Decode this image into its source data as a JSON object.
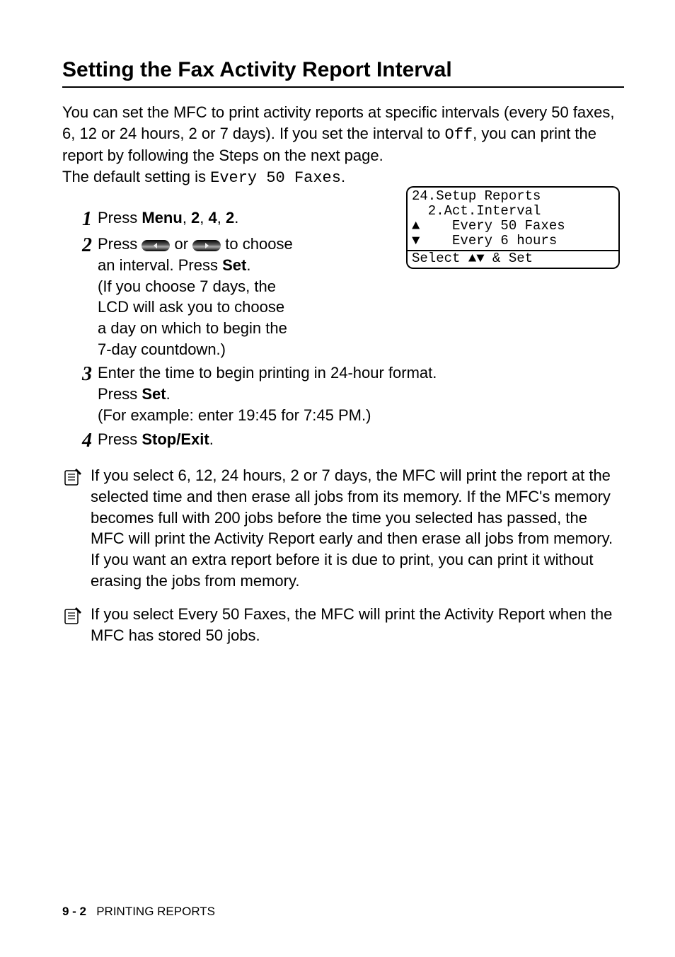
{
  "title": "Setting the Fax Activity Report Interval",
  "intro": {
    "line1": "You can set the MFC to print activity reports at specific intervals (every 50 faxes, 6, 12 or 24 hours, 2 or 7 days). If you set the interval to ",
    "off": "Off",
    "line2": ", you can print the report by following the Steps on the next page.",
    "line3a": "The default setting is ",
    "default_mono": "Every 50 Faxes",
    "line3b": "."
  },
  "steps": {
    "s1": {
      "num": "1",
      "a": "Press ",
      "menu": "Menu",
      "b": ", ",
      "k1": "2",
      "c": ", ",
      "k2": "4",
      "d": ", ",
      "k3": "2",
      "e": "."
    },
    "s2": {
      "num": "2",
      "a": "Press ",
      "b": " or ",
      "c": " to choose an interval. Press ",
      "set": "Set",
      "d": ".",
      "paren": "(If you choose 7 days, the LCD will ask you to choose a day on which to begin the 7-day countdown.)"
    },
    "s3": {
      "num": "3",
      "a": "Enter the time to begin printing in 24-hour format.",
      "b": "Press ",
      "set": "Set",
      "c": ".",
      "paren": "(For example: enter 19:45 for 7:45 PM.)"
    },
    "s4": {
      "num": "4",
      "a": "Press ",
      "stop": "Stop/Exit",
      "b": "."
    }
  },
  "lcd": {
    "l1": "24.Setup Reports",
    "l2": "  2.Act.Interval",
    "l3": "▲    Every 50 Faxes",
    "l4": "▼    Every 6 hours",
    "l5": "Select ▲▼ & Set"
  },
  "notes": {
    "n1": "If you select 6, 12, 24 hours, 2 or 7 days, the MFC will print the report at the selected time and then erase all jobs from its memory. If the MFC's memory becomes full with 200 jobs before the time you selected has passed, the MFC will print the Activity Report early and then erase all jobs from memory. If you want an extra report before it is due to print, you can print it without erasing the jobs from memory.",
    "n2": "If you select Every 50 Faxes, the MFC will print the Activity Report when the MFC has stored 50 jobs."
  },
  "footer": {
    "page": "9 - 2",
    "chapter": "PRINTING REPORTS"
  }
}
